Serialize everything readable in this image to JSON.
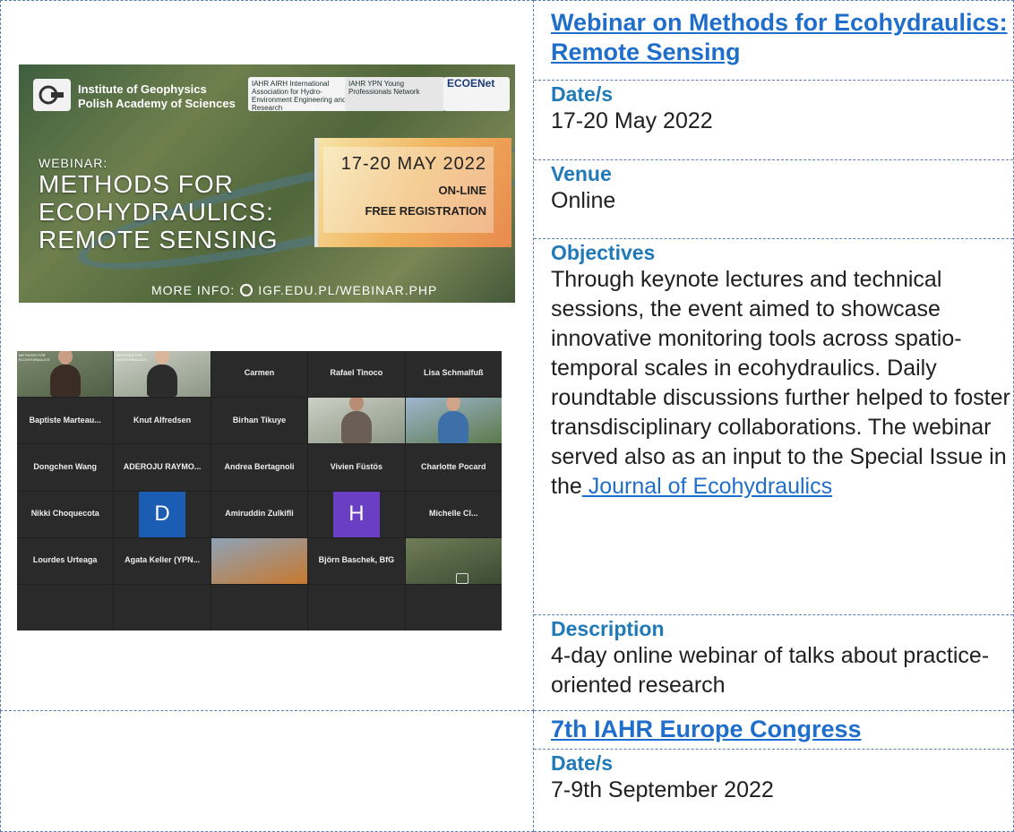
{
  "events": [
    {
      "title": "Webinar on Methods for Ecohydraulics: Remote Sensing",
      "date_label": "Date/s",
      "date_value": "17-20 May 2022",
      "venue_label": "Venue",
      "venue_value": "Online",
      "objectives_label": "Objectives",
      "objectives_text": "Through keynote lectures and technical sessions, the event aimed to showcase innovative monitoring tools across spatio-temporal scales in ecohydraulics. Daily roundtable discussions further helped to foster transdisciplinary collaborations. The webinar served also as an input to the Special Issue in the",
      "objectives_link": " Journal of Ecohydraulics",
      "description_label": "Description",
      "description_text": "4-day online webinar of talks about practice-oriented research"
    },
    {
      "title": "7th IAHR Europe Congress",
      "date_label": "Date/s",
      "date_value": "7-9th September 2022"
    }
  ],
  "poster": {
    "institute_line1": "Institute of Geophysics",
    "institute_line2": "Polish Academy of Sciences",
    "badge_iahr": "IAHR AIRH International Association for Hydro-Environment Engineering and Research",
    "badge_ypn": "IAHR YPN Young Professionals Network",
    "badge_ecoenet": "ECOENet",
    "webinar_label": "WEBINAR:",
    "title_line1": "METHODS FOR",
    "title_line2": "ECOHYDRAULICS:",
    "title_line3": "REMOTE SENSING",
    "dates": "17-20 MAY 2022",
    "online": "ON-LINE",
    "registration": "FREE REGISTRATION",
    "more_info": "MORE INFO:",
    "url": "IGF.EDU.PL/WEBINAR.PHP"
  },
  "zoom": {
    "participants": [
      "",
      "",
      "Carmen",
      "Rafael Tinoco",
      "Lisa Schmalfuß",
      "Baptiste Marteau...",
      "Knut Alfredsen",
      "Birhan Tikuye",
      "",
      "",
      "Dongchen Wang",
      "ADEROJU RAYMO...",
      "Andrea Bertagnoli",
      "Vivien Füstös",
      "Charlotte Pocard",
      "Nikki Choquecota",
      "",
      "Amiruddin Zulkifli",
      "",
      "Michelle Cl...",
      "Lourdes Urteaga",
      "Agata Keller (YPN...",
      "",
      "Björn Baschek, BfG",
      ""
    ],
    "avatar_d": "D",
    "avatar_h": "H"
  }
}
